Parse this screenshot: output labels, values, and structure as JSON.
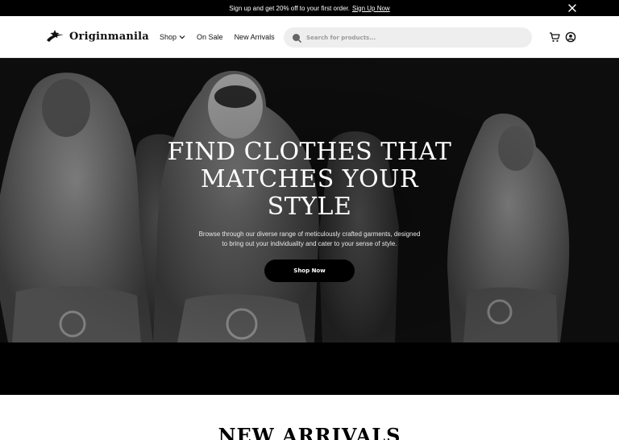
{
  "promo": {
    "text": "Sign up and get 20% off to your first order.",
    "link": "Sign Up Now",
    "close_icon": "close-icon"
  },
  "header": {
    "logo_text": "Originmanila",
    "logo_icon": "star-swoosh-logo",
    "nav": [
      {
        "label": "Shop",
        "icon": "chevron-down-icon"
      },
      {
        "label": "On Sale"
      },
      {
        "label": "New Arrivals"
      }
    ],
    "search_placeholder": "Search for products...",
    "icons": [
      "search-icon",
      "cart-icon",
      "account-icon"
    ]
  },
  "hero": {
    "title_line1": "FIND CLOTHES THAT",
    "title_line2": "MATCHES YOUR",
    "title_line3": "STYLE",
    "subtitle_line1": "Browse through our diverse range of meticulously crafted garments, designed",
    "subtitle_line2": "to bring out your individuality and cater to your sense of style.",
    "cta": "Shop Now"
  },
  "new_arrivals": {
    "title": "NEW ARRIVALS"
  },
  "colors": {
    "primary": "#000000",
    "background": "#ffffff",
    "search_bg": "#eeeeee"
  }
}
